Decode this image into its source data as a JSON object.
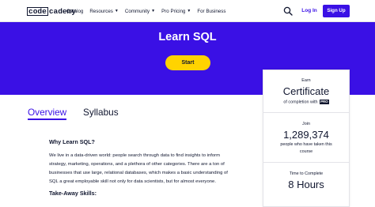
{
  "nav": {
    "logo_code": "code",
    "logo_rest": "cademy",
    "links": [
      {
        "label": "Catalog",
        "dropdown": false
      },
      {
        "label": "Resources",
        "dropdown": true
      },
      {
        "label": "Community",
        "dropdown": true
      },
      {
        "label": "Pro Pricing",
        "dropdown": true
      },
      {
        "label": "For Business",
        "dropdown": false
      }
    ],
    "login_label": "Log In",
    "signup_label": "Sign Up"
  },
  "hero": {
    "title": "Learn SQL",
    "start_label": "Start"
  },
  "tabs": {
    "overview": "Overview",
    "syllabus": "Syllabus"
  },
  "main": {
    "why_title": "Why Learn SQL?",
    "why_lines": [
      "We live in a data-driven world: people search through data to find insights to inform",
      "strategy, marketing, operations, and a plethora of other categories. There are a ton of",
      "businesses that use large, relational databases, which makes a basic understanding of",
      "SQL a great employable skill not only for data scientists, but for almost everyone."
    ],
    "takeaway_title": "Take-Away Skills:"
  },
  "card": {
    "earn_label": "Earn",
    "certificate": "Certificate",
    "completion_text": "of completion with",
    "pro_badge": "PRO",
    "join_label": "Join",
    "learner_count": "1,289,374",
    "taken_line1": "people who have taken this",
    "taken_line2": "course",
    "time_label": "Time to Complete",
    "time_value": "8 Hours"
  },
  "colors": {
    "brand": "#3a10e5",
    "accent": "#ffd300",
    "text": "#10162f"
  }
}
